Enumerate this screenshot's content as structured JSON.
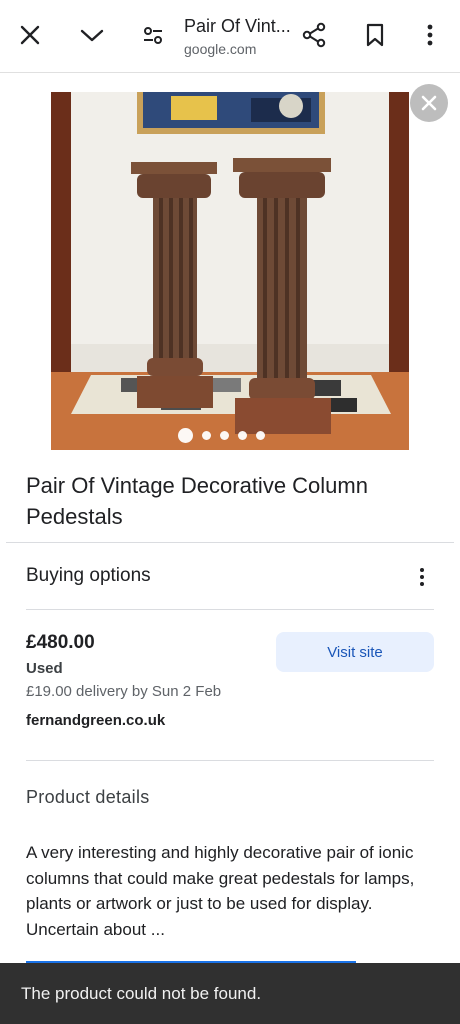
{
  "toolbar": {
    "title": "Pair Of Vint...",
    "url": "google.com"
  },
  "product": {
    "title": "Pair Of Vintage Decorative Column Pedestals",
    "image_dots": 5,
    "active_dot": 0
  },
  "buying": {
    "heading": "Buying options",
    "price": "£480.00",
    "condition": "Used",
    "delivery": "£19.00 delivery by Sun 2 Feb",
    "seller": "fernandgreen.co.uk",
    "visit_label": "Visit site"
  },
  "details": {
    "heading": "Product details",
    "description": "A very interesting and highly decorative pair of ionic columns that could make great pedestals for lamps, plants or artwork or just to be used for display. Uncertain about ..."
  },
  "toast": {
    "message": "The product could not be found."
  },
  "colors": {
    "accent": "#1a56b8",
    "button_bg": "#e8f0fe",
    "toast_bg": "#303030"
  }
}
